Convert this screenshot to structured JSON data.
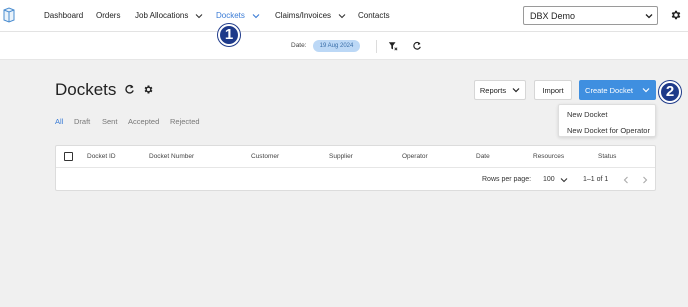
{
  "nav": {
    "logo_icon": "cube-logo-icon",
    "items": [
      {
        "label": "Dashboard",
        "has_dropdown": false
      },
      {
        "label": "Orders",
        "has_dropdown": false
      },
      {
        "label": "Job Allocations",
        "has_dropdown": true
      },
      {
        "label": "Dockets",
        "has_dropdown": true,
        "active": true
      },
      {
        "label": "Claims/Invoices",
        "has_dropdown": true
      },
      {
        "label": "Contacts",
        "has_dropdown": false
      }
    ],
    "company_select": {
      "value": "DBX Demo"
    },
    "settings_icon": "gear-icon"
  },
  "date_bar": {
    "label": "Date:",
    "date_value": "19 Aug 2024",
    "filter_icon": "filter-clear-icon",
    "refresh_icon": "refresh-icon"
  },
  "markers": [
    "1",
    "2"
  ],
  "page": {
    "title": "Dockets",
    "refresh_icon": "refresh-icon",
    "settings_icon": "gear-icon"
  },
  "actions": {
    "reports_label": "Reports",
    "import_label": "Import",
    "create_label": "Create Docket",
    "create_menu": [
      "New Docket",
      "New Docket for Operator"
    ]
  },
  "status_tabs": [
    {
      "label": "All",
      "active": true
    },
    {
      "label": "Draft"
    },
    {
      "label": "Sent"
    },
    {
      "label": "Accepted"
    },
    {
      "label": "Rejected"
    }
  ],
  "table": {
    "columns": [
      "Docket ID",
      "Docket Number",
      "Customer",
      "Supplier",
      "Operator",
      "Date",
      "Resources",
      "Status"
    ],
    "rows": [],
    "rows_per_page_label": "Rows per page:",
    "rows_per_page_value": "100",
    "range_text": "1–1 of 1"
  },
  "colors": {
    "accent": "#3f8fe0",
    "active_text": "#3a7bd5",
    "date_pill_bg": "#bcd8f6",
    "marker": "#1e3a8a"
  }
}
